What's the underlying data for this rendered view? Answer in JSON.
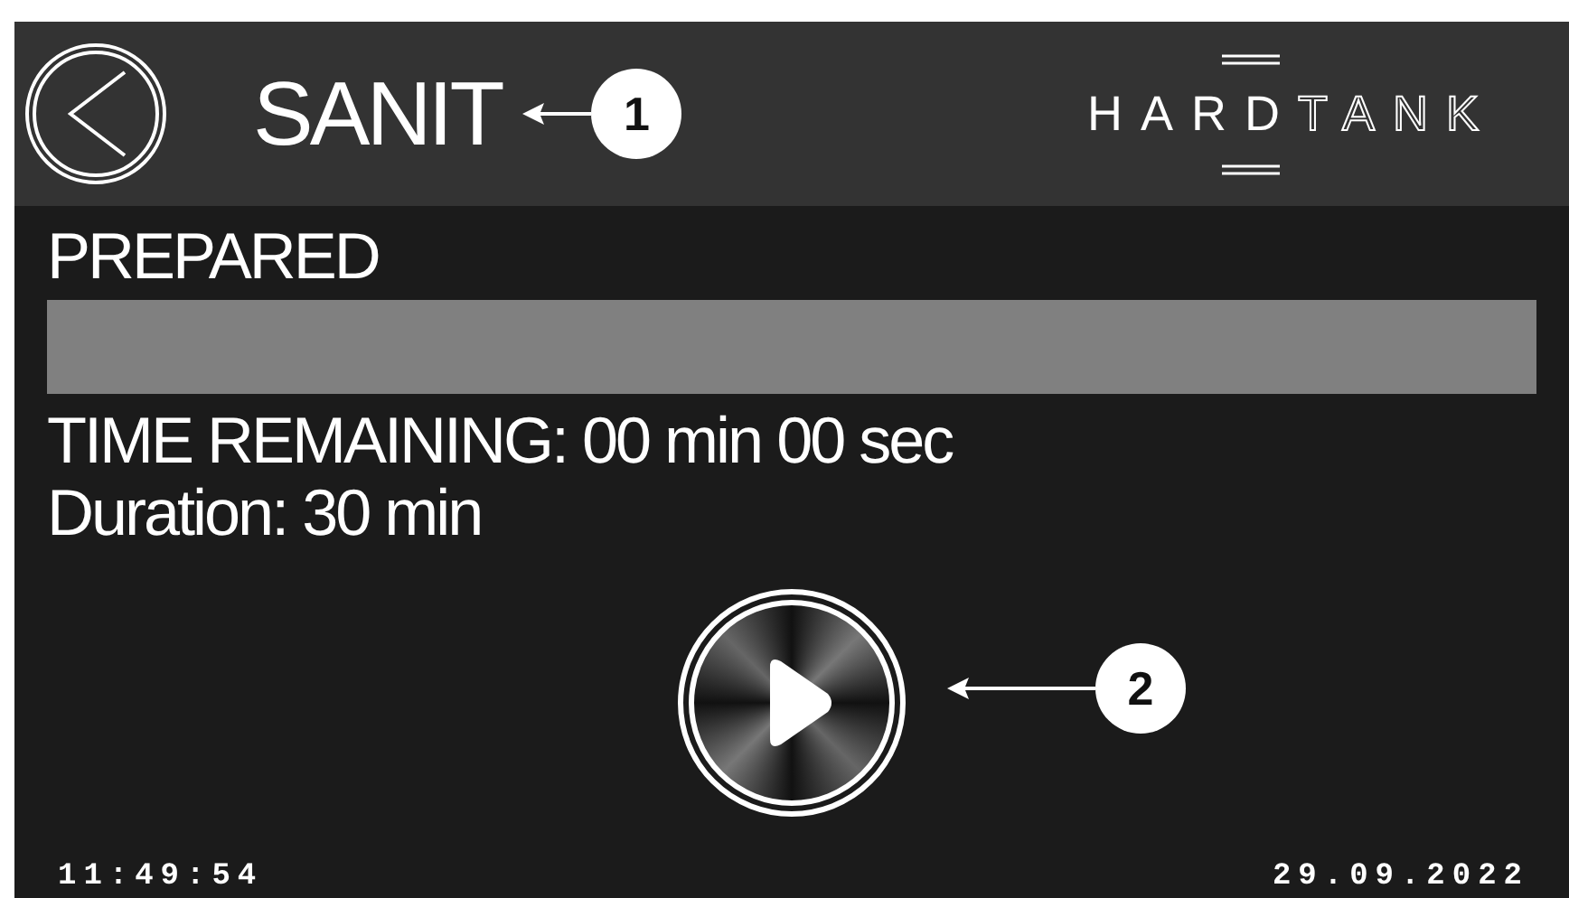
{
  "header": {
    "title": "SANIT",
    "logo": {
      "solid": "HARD",
      "outline": "TANK"
    }
  },
  "status": "PREPARED",
  "progress": {
    "level": 0
  },
  "time_remaining": "TIME REMAINING: 00 min 00 sec",
  "duration": "Duration: 30 min",
  "callouts": [
    {
      "label": "1"
    },
    {
      "label": "2"
    }
  ],
  "footer": {
    "time": "11:49:54",
    "date": "29.09.2022"
  }
}
